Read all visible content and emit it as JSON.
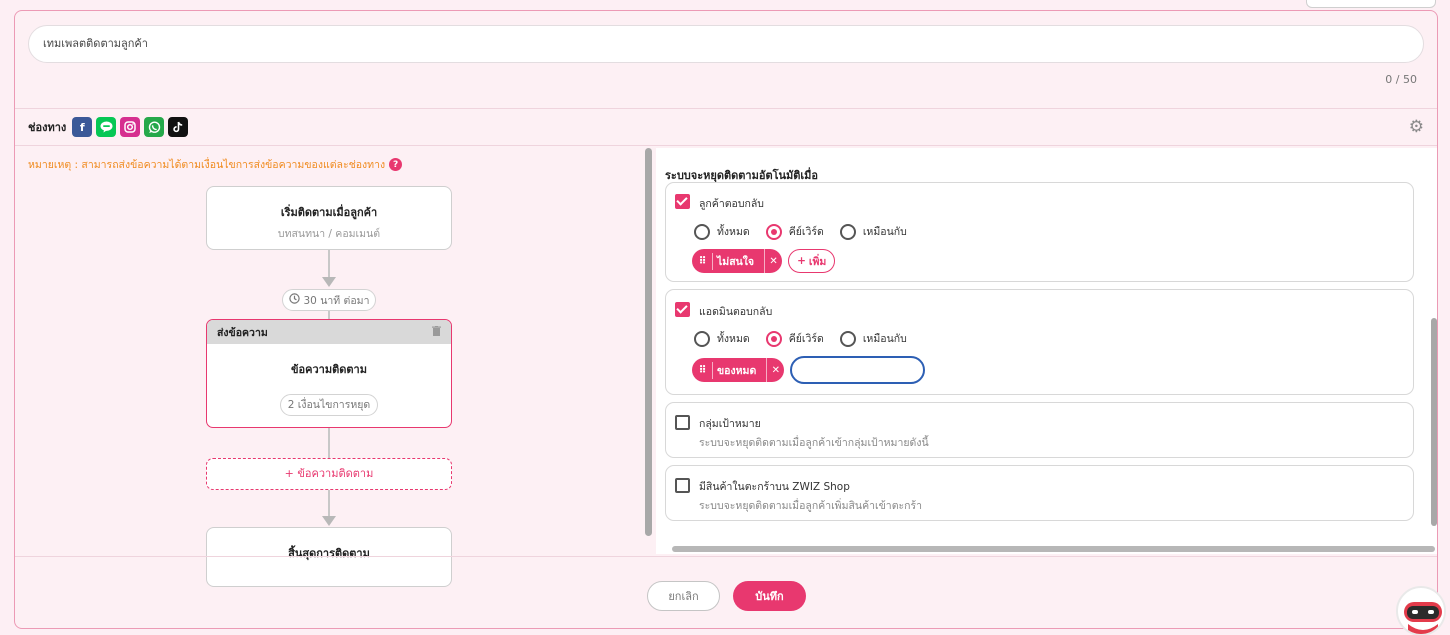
{
  "template_name": {
    "value": "เทมเพลตติดตามลูกค้า",
    "counter": "0 / 50"
  },
  "channels": {
    "label": "ช่องทาง",
    "icons": [
      {
        "name": "facebook-icon",
        "glyph": "f",
        "color": "#3b5998"
      },
      {
        "name": "line-icon",
        "glyph": "◉",
        "color": "#06c755"
      },
      {
        "name": "instagram-icon",
        "glyph": "◎",
        "color": "#d62f8f"
      },
      {
        "name": "whatsapp-icon",
        "glyph": "✆",
        "color": "#25a84a"
      },
      {
        "name": "tiktok-icon",
        "glyph": "♪",
        "color": "#111111"
      }
    ],
    "settings_icon": "gear-icon"
  },
  "note": "หมายเหตุ : สามารถส่งข้อความได้ตามเงื่อนไขการส่งข้อความของแต่ละช่องทาง",
  "flow": {
    "start": {
      "title": "เริ่มติดตามเมื่อลูกค้า",
      "subtitle": "บทสนทนา / คอมเมนต์"
    },
    "wait": "30 นาที ต่อมา",
    "message": {
      "header": "ส่งข้อความ",
      "title": "ข้อความติดตาม",
      "condition": "2 เงื่อนไขการหยุด"
    },
    "add_follow": "+ ข้อความติดตาม",
    "end": {
      "title": "สิ้นสุดการติดตาม"
    }
  },
  "stop_settings": {
    "title": "ระบบจะหยุดติดตามอัตโนมัติเมื่อ",
    "customer_reply": {
      "label": "ลูกค้าตอบกลับ",
      "checked": true,
      "options": [
        "ทั้งหมด",
        "คีย์เวิร์ด",
        "เหมือนกับ"
      ],
      "selected": "คีย์เวิร์ด",
      "keywords": [
        "ไม่สนใจ"
      ],
      "add_label": "เพิ่ม"
    },
    "admin_reply": {
      "label": "แอดมินตอบกลับ",
      "checked": true,
      "options": [
        "ทั้งหมด",
        "คีย์เวิร์ด",
        "เหมือนกับ"
      ],
      "selected": "คีย์เวิร์ด",
      "keywords": [
        "ของหมด"
      ],
      "input_value": ""
    },
    "target_group": {
      "label": "กลุ่มเป้าหมาย",
      "desc": "ระบบจะหยุดติดตามเมื่อลูกค้าเข้ากลุ่มเป้าหมายดังนี้",
      "checked": false
    },
    "cart": {
      "label": "มีสินค้าในตะกร้าบน ZWIZ Shop",
      "desc": "ระบบจะหยุดติดตามเมื่อลูกค้าเพิ่มสินค้าเข้าตะกร้า",
      "checked": false
    }
  },
  "footer": {
    "cancel": "ยกเลิก",
    "save": "บันทึก"
  },
  "colors": {
    "accent": "#e8386f",
    "note": "#f08b1f",
    "panel_border": "#ec9ab5",
    "panel_bg": "#fdf0f4"
  }
}
